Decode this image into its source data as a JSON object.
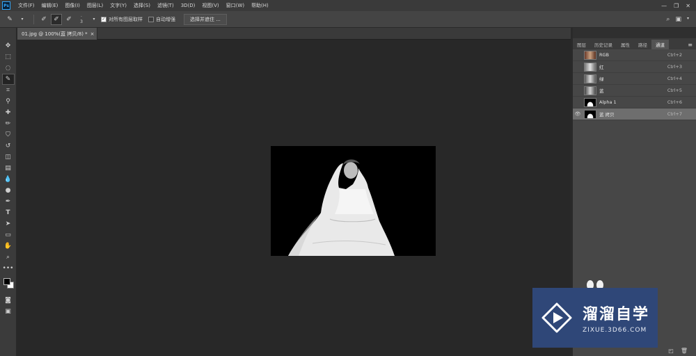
{
  "app": {
    "logo": "Ps"
  },
  "menu": {
    "items": [
      "文件(F)",
      "编辑(E)",
      "图像(I)",
      "图层(L)",
      "文字(Y)",
      "选择(S)",
      "滤镜(T)",
      "3D(D)",
      "视图(V)",
      "窗口(W)",
      "帮助(H)"
    ]
  },
  "window_controls": {
    "minimize": "—",
    "maximize": "❐",
    "close": "✕"
  },
  "options": {
    "size_value": "3",
    "sample_all_label": "对所有图层取样",
    "auto_enhance_label": "自动增强",
    "select_mask_label": "选择并遮住 ..."
  },
  "document": {
    "tab_title": "01.jpg @ 100%(蓝 拷贝/8) *",
    "close": "×"
  },
  "panel": {
    "tabs": [
      "图层",
      "历史记录",
      "属性",
      "路径",
      "通道"
    ],
    "active_tab": "通道",
    "menu_icon": "≡",
    "channels": [
      {
        "name": "RGB",
        "shortcut": "Ctrl+2"
      },
      {
        "name": "红",
        "shortcut": "Ctrl+3"
      },
      {
        "name": "绿",
        "shortcut": "Ctrl+4"
      },
      {
        "name": "蓝",
        "shortcut": "Ctrl+5"
      },
      {
        "name": "Alpha 1",
        "shortcut": "Ctrl+6"
      },
      {
        "name": "蓝 拷贝",
        "shortcut": "Ctrl+7"
      }
    ]
  },
  "watermark": {
    "title": "溜溜自学",
    "url": "ZIXUE.3D66.COM"
  },
  "colors": {
    "accent": "#31a8ff",
    "panel_bg": "#474747",
    "canvas_bg": "#282828",
    "watermark_bg": "#2f4778"
  }
}
